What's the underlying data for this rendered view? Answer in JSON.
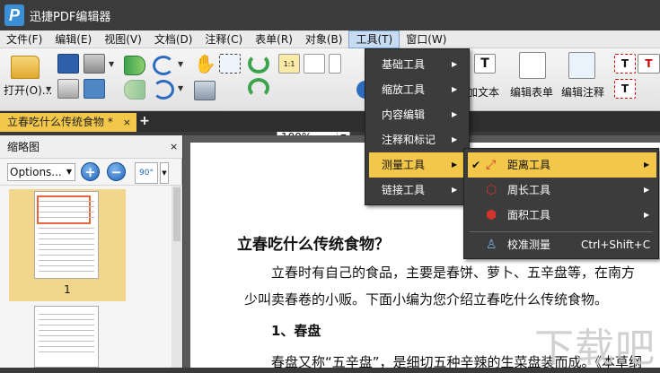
{
  "app": {
    "logo": "P",
    "title": "迅捷PDF编辑器"
  },
  "menubar": [
    "文件(F)",
    "编辑(E)",
    "视图(V)",
    "文档(D)",
    "注释(C)",
    "表单(R)",
    "对象(B)",
    "工具(T)",
    "窗口(W)"
  ],
  "toolbar": {
    "open_label": "打开(O)...",
    "zoom_value": "100%",
    "add_text_label": "加文本",
    "edit_form_label": "编辑表单",
    "edit_annotation_label": "编辑注释"
  },
  "tab": {
    "title": "立春吃什么传统食物 *",
    "close": "×",
    "add": "+"
  },
  "sidebar": {
    "title": "缩略图",
    "close": "×",
    "options": "Options...",
    "zoom_in": "+",
    "zoom_out": "−",
    "rotate": "90°",
    "page_num": "1"
  },
  "document": {
    "title": "立春吃什么传统食物？",
    "para1_line1": "立春时有自己的食品，主要是春饼、萝卜、五辛盘等，在南方",
    "para1_line2": "少叫卖春卷的小贩。下面小编为您介绍立春吃什么传统食物。",
    "heading2": "1、春盘",
    "para2": "春盘又称“五辛盘”，是细切五种辛辣的生菜盘装而成。《本草纲"
  },
  "tools_menu": [
    {
      "label": "基础工具"
    },
    {
      "label": "缩放工具"
    },
    {
      "label": "内容编辑"
    },
    {
      "label": "注释和标记"
    },
    {
      "label": "测量工具",
      "highlighted": true
    },
    {
      "label": "链接工具"
    }
  ],
  "measure_menu": [
    {
      "label": "距离工具",
      "checked": true,
      "highlighted": true,
      "icon": "distance-icon"
    },
    {
      "label": "周长工具",
      "icon": "perimeter-icon"
    },
    {
      "label": "面积工具",
      "icon": "area-icon"
    },
    {
      "label": "校准测量",
      "shortcut": "Ctrl+Shift+C",
      "icon": "calibrate-icon"
    }
  ],
  "watermark": "下载吧",
  "colors": {
    "accent": "#f3c84a",
    "menu_bg": "#3c3c3c",
    "titlebar": "#3b3b3b"
  }
}
